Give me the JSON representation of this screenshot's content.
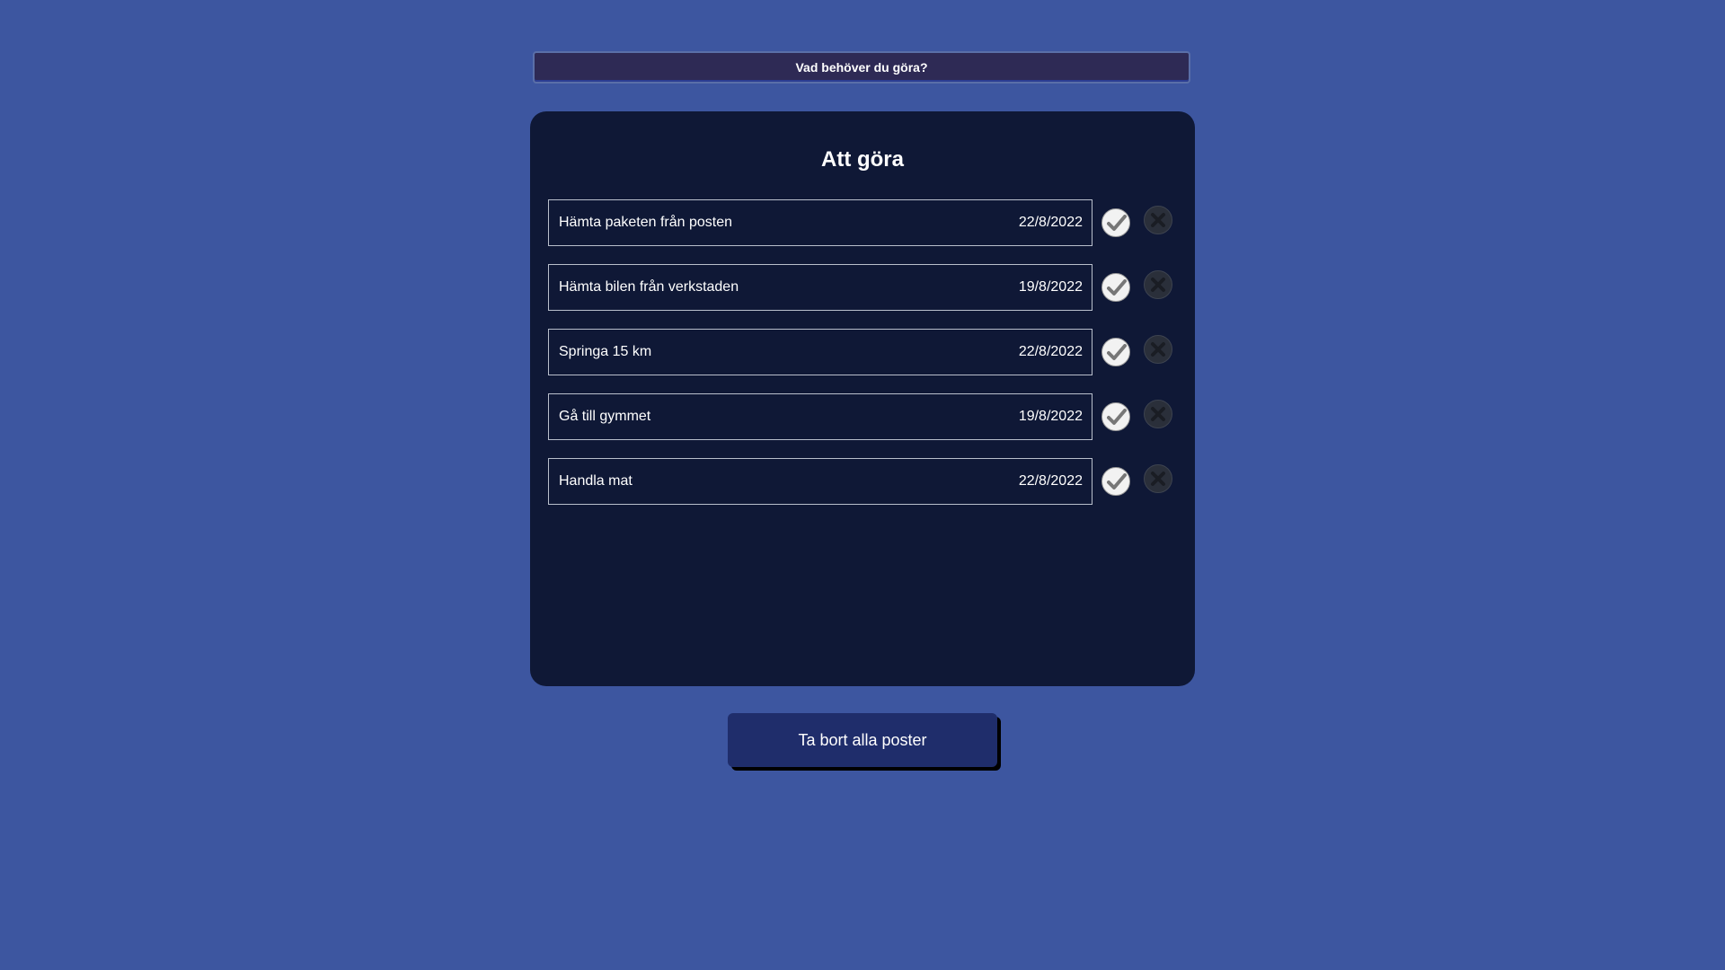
{
  "input": {
    "placeholder": "Vad behöver du göra?"
  },
  "panel": {
    "title": "Att göra"
  },
  "tasks": [
    {
      "text": "Hämta paketen från posten",
      "date": "22/8/2022"
    },
    {
      "text": "Hämta bilen från verkstaden",
      "date": "19/8/2022"
    },
    {
      "text": "Springa 15 km",
      "date": "22/8/2022"
    },
    {
      "text": "Gå till gymmet",
      "date": "19/8/2022"
    },
    {
      "text": "Handla mat",
      "date": "22/8/2022"
    }
  ],
  "icons": {
    "complete": "check-icon",
    "remove": "close-icon"
  },
  "colors": {
    "background": "#3d56a0",
    "panel": "#0f1836",
    "input": "#2e2a55",
    "button": "#1f2d6b"
  },
  "actions": {
    "clear_all_label": "Ta bort alla poster"
  }
}
